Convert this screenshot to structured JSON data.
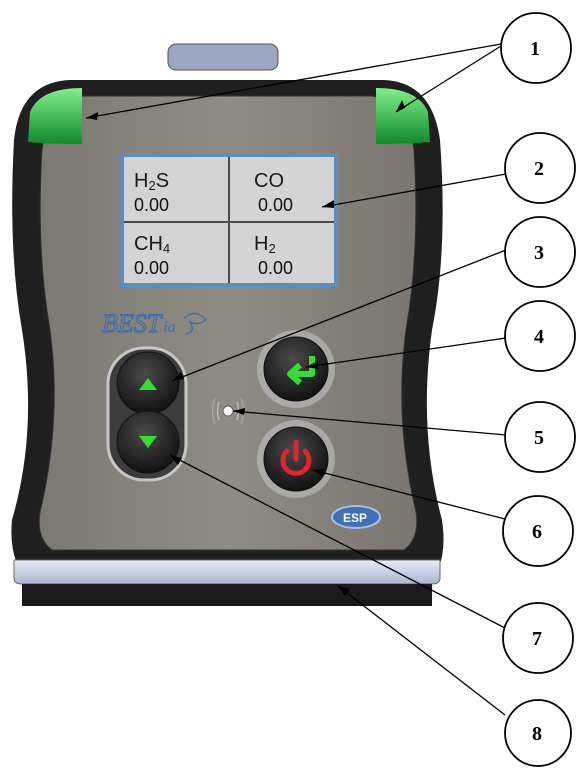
{
  "display": {
    "cells": [
      {
        "gas": "H",
        "sub": "2",
        "gas2": "S",
        "value": "0.00"
      },
      {
        "gas": "CO",
        "sub": "",
        "gas2": "",
        "value": "0.00"
      },
      {
        "gas": "CH",
        "sub": "4",
        "gas2": "",
        "value": "0.00"
      },
      {
        "gas": "H",
        "sub": "2",
        "gas2": "",
        "value": "0.00"
      }
    ]
  },
  "brand": {
    "main": "BEST",
    "suffix": "ia"
  },
  "region_badge": "ESP",
  "callouts": [
    "1",
    "2",
    "3",
    "4",
    "5",
    "6",
    "7",
    "8"
  ],
  "colors": {
    "body": "#8a8680",
    "frame": "#1e1e1e",
    "led": "#2ecc4a",
    "arrow_green": "#33dd33",
    "power_red": "#e0242a",
    "screen_border": "#5b8fc4"
  }
}
